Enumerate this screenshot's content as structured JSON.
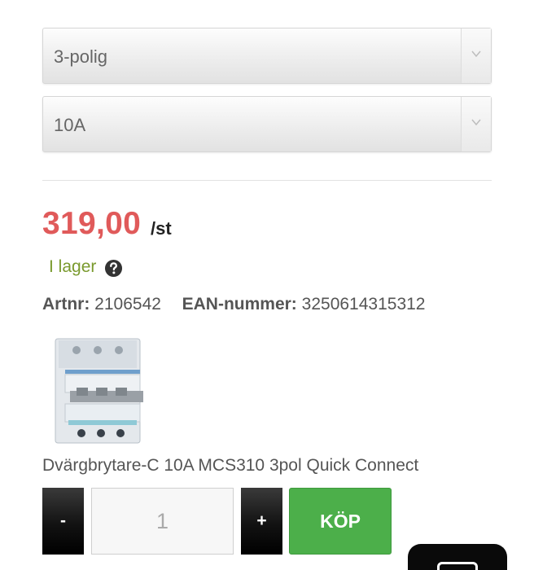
{
  "variant_selects": [
    {
      "value": "3-polig"
    },
    {
      "value": "10A"
    }
  ],
  "price": {
    "amount": "319,00",
    "unit": "/st"
  },
  "stock": {
    "status": "I lager"
  },
  "article": {
    "artnr_label": "Artnr:",
    "artnr_value": "2106542",
    "ean_label": "EAN-nummer:",
    "ean_value": "3250614315312"
  },
  "product": {
    "name": "Dvärgbrytare-C 10A MCS310 3pol Quick Connect"
  },
  "cart": {
    "minus_label": "-",
    "quantity": "1",
    "plus_label": "+",
    "buy_label": "KÖP"
  },
  "colors": {
    "price": "#e05a5a",
    "in_stock": "#7a9a2e",
    "buy_button": "#4caf4a"
  }
}
